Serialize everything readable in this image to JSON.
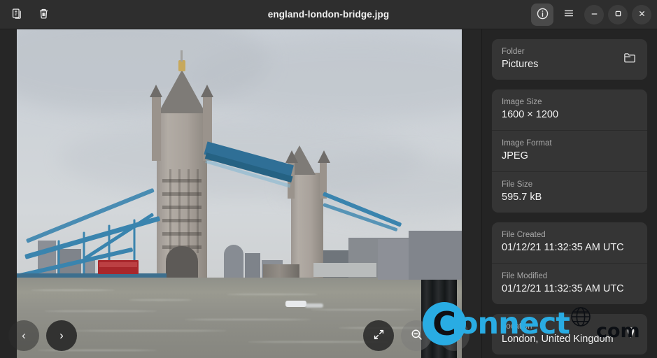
{
  "titlebar": {
    "file_name": "england-london-bridge.jpg",
    "copy_icon": "copy-icon",
    "trash_icon": "trash-icon",
    "info_icon": "info-icon",
    "menu_icon": "hamburger-menu-icon",
    "minimize_icon": "minimize-icon",
    "maximize_icon": "maximize-icon",
    "close_icon": "close-icon"
  },
  "viewer": {
    "prev_label": "‹",
    "next_label": "›",
    "fullscreen_icon": "fullscreen-expand-icon",
    "zoom_out_icon": "zoom-out-icon",
    "zoom_in_icon": "zoom-in-icon",
    "watermark": {
      "logo_letter": "C",
      "word": "onnect",
      "tld": "com",
      "globe_icon": "globe-icon",
      "brand_color": "#29ace3"
    }
  },
  "sidebar": {
    "cards": [
      {
        "rows": [
          {
            "label": "Folder",
            "value": "Pictures",
            "icon": "folder-icon",
            "interactable": true
          }
        ]
      },
      {
        "rows": [
          {
            "label": "Image Size",
            "value": "1600 × 1200",
            "icon": null,
            "interactable": false
          },
          {
            "label": "Image Format",
            "value": "JPEG",
            "icon": null,
            "interactable": false
          },
          {
            "label": "File Size",
            "value": "595.7 kB",
            "icon": null,
            "interactable": false
          }
        ]
      },
      {
        "rows": [
          {
            "label": "File Created",
            "value": "01/12/21 11:32:35 AM UTC",
            "icon": null,
            "interactable": false
          },
          {
            "label": "File Modified",
            "value": "01/12/21 11:32:35 AM UTC",
            "icon": null,
            "interactable": false
          }
        ]
      },
      {
        "rows": [
          {
            "label": "Location",
            "value": "London, United Kingdom",
            "icon": "map-pin-icon",
            "interactable": true
          }
        ]
      }
    ]
  },
  "colors": {
    "titlebar_bg": "#2e2e2e",
    "sidebar_bg": "#242424",
    "card_bg": "#353535",
    "viewer_bg": "#262626",
    "label_text": "#a8a8a8",
    "value_text": "#f1f1f1"
  }
}
